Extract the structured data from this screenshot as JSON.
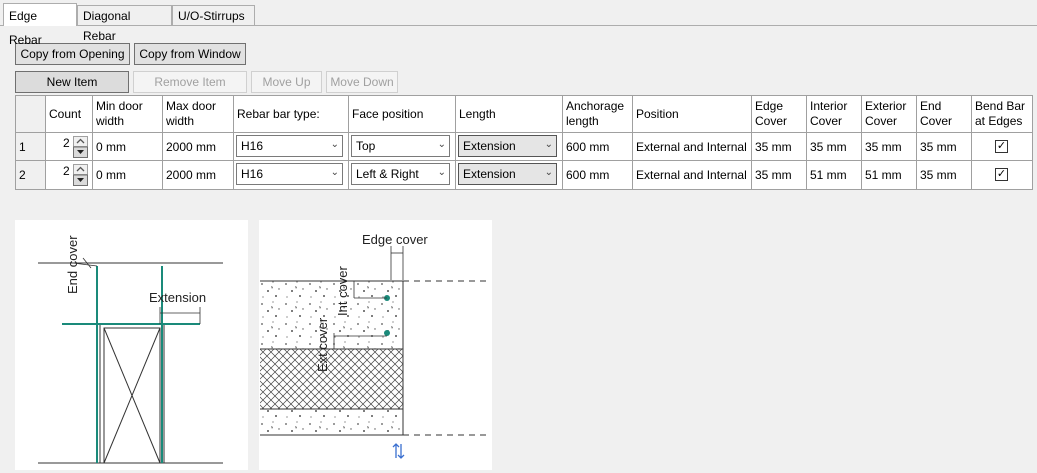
{
  "tabs": [
    {
      "label": "Edge Rebar",
      "active": true
    },
    {
      "label": "Diagonal Rebar",
      "active": false
    },
    {
      "label": "U/O-Stirrups",
      "active": false
    }
  ],
  "buttons": {
    "copy_from_opening": "Copy from Opening",
    "copy_from_window": "Copy from Window",
    "new_item": "New Item",
    "remove_item": "Remove Item",
    "move_up": "Move Up",
    "move_down": "Move Down"
  },
  "table": {
    "columns": [
      "Count",
      "Min door width",
      "Max door width",
      "Rebar bar type:",
      "Face position",
      "Length",
      "Anchorage length",
      "Position",
      "Edge Cover",
      "Interior Cover",
      "Exterior Cover",
      "End Cover",
      "Bend Bar at Edges"
    ],
    "rows": [
      {
        "index": "1",
        "count": "2",
        "min_width": "0 mm",
        "max_width": "2000 mm",
        "bar_type": "H16",
        "face": "Top",
        "length": "Extension",
        "anchorage": "600 mm",
        "position": "External and Internal",
        "edge_cover": "35 mm",
        "interior_cover": "35 mm",
        "exterior_cover": "35 mm",
        "end_cover": "35 mm",
        "bend": true
      },
      {
        "index": "2",
        "count": "2",
        "min_width": "0 mm",
        "max_width": "2000 mm",
        "bar_type": "H16",
        "face": "Left & Right",
        "length": "Extension",
        "anchorage": "600 mm",
        "position": "External and Internal",
        "edge_cover": "35 mm",
        "interior_cover": "51 mm",
        "exterior_cover": "51 mm",
        "end_cover": "35 mm",
        "bend": true
      }
    ]
  },
  "diagram1": {
    "end_cover": "End cover",
    "extension": "Extension"
  },
  "diagram2": {
    "edge_cover": "Edge cover",
    "int_cover": "Int cover",
    "ext_cover": "Ext cover"
  },
  "icons": {
    "flip": "swap-vertical-icon",
    "checkmark": "✓",
    "combo_arrow": "⌄"
  },
  "colors": {
    "rebar": "#1a8a7a",
    "line": "#333333"
  }
}
